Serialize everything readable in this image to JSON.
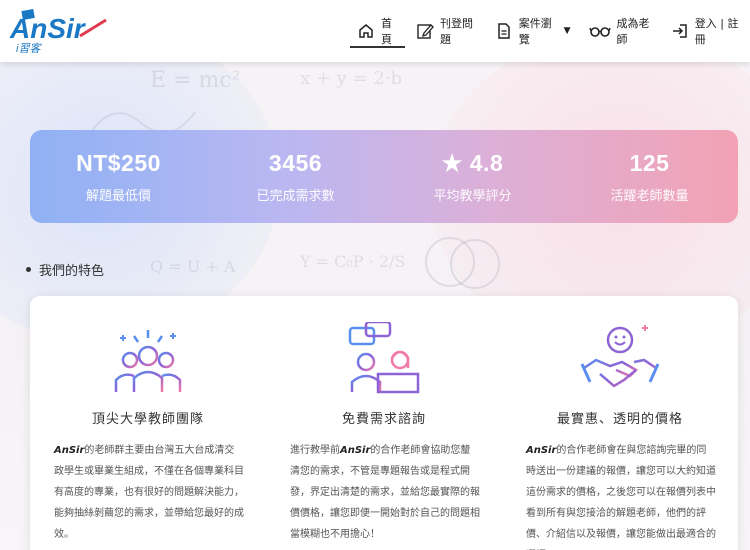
{
  "header": {
    "logo": {
      "text": "AnSir",
      "subtext": "i習客"
    },
    "nav": [
      {
        "label": "首頁",
        "icon": "home-icon",
        "active": true
      },
      {
        "label": "刊登問題",
        "icon": "edit-icon"
      },
      {
        "label": "案件瀏覽",
        "icon": "document-icon",
        "dropdown": true
      },
      {
        "label": "成為老師",
        "icon": "glasses-icon"
      },
      {
        "label": "登入 | 註冊",
        "icon": "login-icon"
      }
    ]
  },
  "stats": [
    {
      "value": "NT$250",
      "label": "解題最低價"
    },
    {
      "value": "3456",
      "label": "已完成需求數"
    },
    {
      "value": "★ 4.8",
      "label": "平均教學評分"
    },
    {
      "value": "125",
      "label": "活躍老師數量"
    }
  ],
  "section": {
    "title": "我們的特色"
  },
  "features": [
    {
      "icon": "teachers-group-icon",
      "title": "頂尖大學教師團隊",
      "brand": "AnSir",
      "desc": "的老師群主要由台灣五大台成清交政學生或畢業生組成，不僅在各個專業科目有高度的專業，也有很好的問題解決能力，能夠抽絲剝繭您的需求，並帶給您最好的成效。"
    },
    {
      "icon": "consultation-chat-icon",
      "title": "免費需求諮詢",
      "prefix": "進行教學前",
      "brand": "AnSir",
      "desc": "的合作老師會協助您釐清您的需求，不管是專題報告或是程式開發，界定出清楚的需求，並給您最實際的報價價格，讓您即便一開始對於自己的問題相當模糊也不用擔心！"
    },
    {
      "icon": "handshake-icon",
      "title": "最實惠、透明的價格",
      "brand": "AnSir",
      "desc": "的合作老師會在與您諮詢完畢的同時送出一份建議的報價，讓您可以大約知道這份需求的價格，之後您可以在報價列表中看到所有與您接洽的解題老師，他們的評價、介紹信以及報價，讓您能做出最適合的選擇。"
    }
  ],
  "colors": {
    "stats_gradient_start": "#8fb1f4",
    "stats_gradient_end": "#f2a2b4",
    "logo_blue": "#1b78c4",
    "logo_red": "#e23b4f",
    "icon_purple": "#8e63d6",
    "icon_pink": "#f07aa8",
    "icon_blue": "#5a8ff0"
  }
}
